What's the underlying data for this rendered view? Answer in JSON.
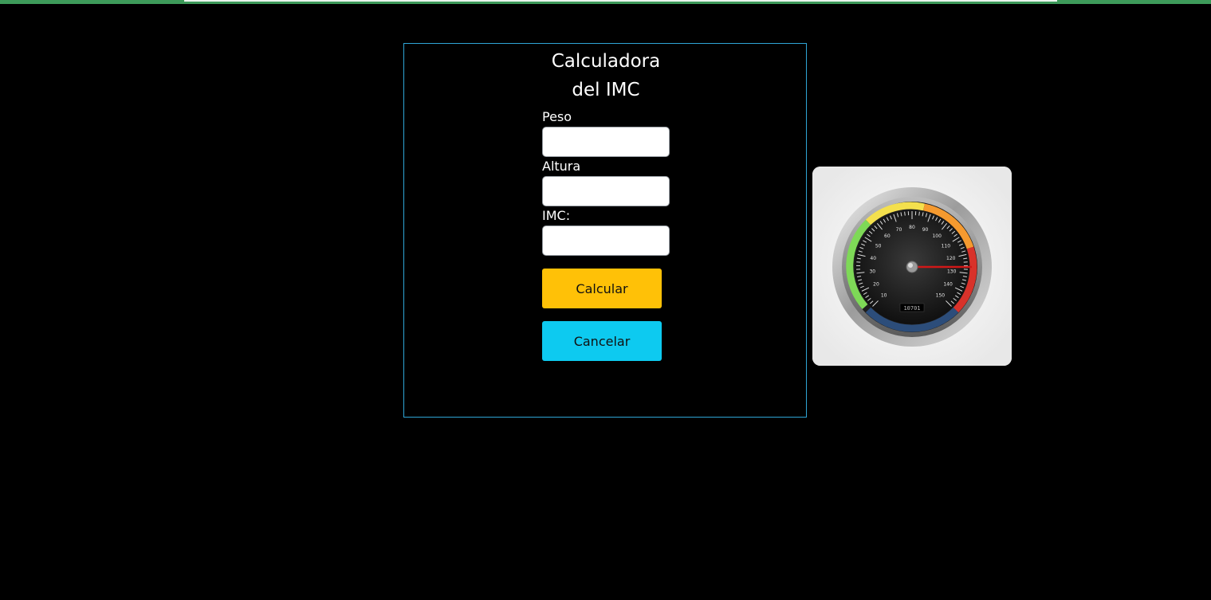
{
  "title": {
    "line1": "Calculadora",
    "line2": "del IMC"
  },
  "form": {
    "peso_label": "Peso",
    "peso_value": "",
    "altura_label": "Altura",
    "altura_value": "",
    "imc_label": "IMC:",
    "imc_value": ""
  },
  "buttons": {
    "calcular": "Calcular",
    "cancelar": "Cancelar"
  },
  "colors": {
    "calcular": "#ffc107",
    "cancelar": "#0dcaf0",
    "card_border": "#2fa5d6"
  },
  "gauge": {
    "image": "speedometer-image",
    "tick_labels": [
      "10",
      "20",
      "30",
      "40",
      "50",
      "60",
      "70",
      "80",
      "90",
      "100",
      "110",
      "120",
      "130",
      "140",
      "150"
    ],
    "odometer": "10701"
  }
}
